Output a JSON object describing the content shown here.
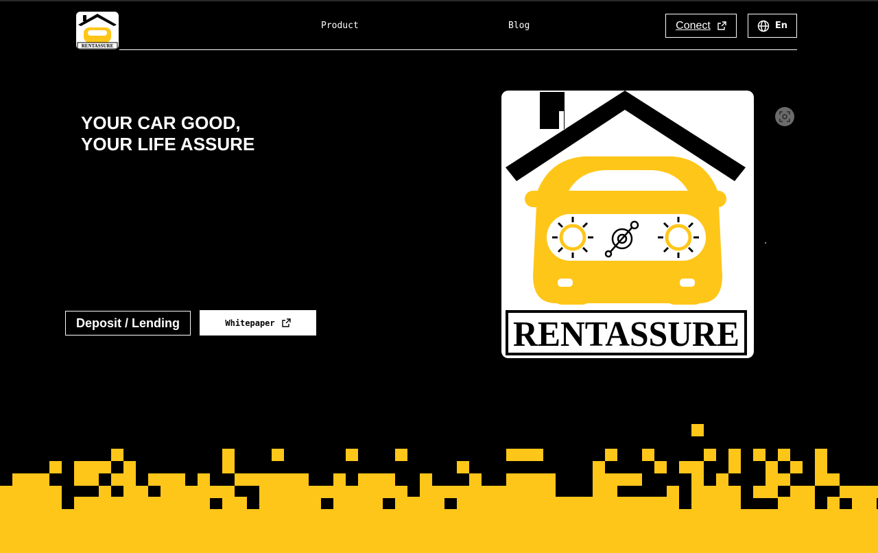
{
  "brand": {
    "name": "RENTASSURE",
    "logo_icon": "house-car-logo"
  },
  "nav": {
    "links": [
      "Product",
      "Blog"
    ]
  },
  "header": {
    "connect_label": "Conect",
    "connect_icon": "external-link-icon",
    "language_label": "En",
    "language_icon": "globe-icon"
  },
  "hero": {
    "title_lines": [
      "YOUR CAR GOOD,",
      "YOUR LIFE ASSURE"
    ],
    "deposit_label": "Deposit / Lending",
    "whitepaper_label": "Whitepaper",
    "whitepaper_icon": "external-link-icon",
    "logo_text": "RENTASSURE",
    "scan_icon": "scan-icon"
  },
  "colors": {
    "background": "#000000",
    "accent": "#FFC61A",
    "text": "#FFFFFF"
  }
}
